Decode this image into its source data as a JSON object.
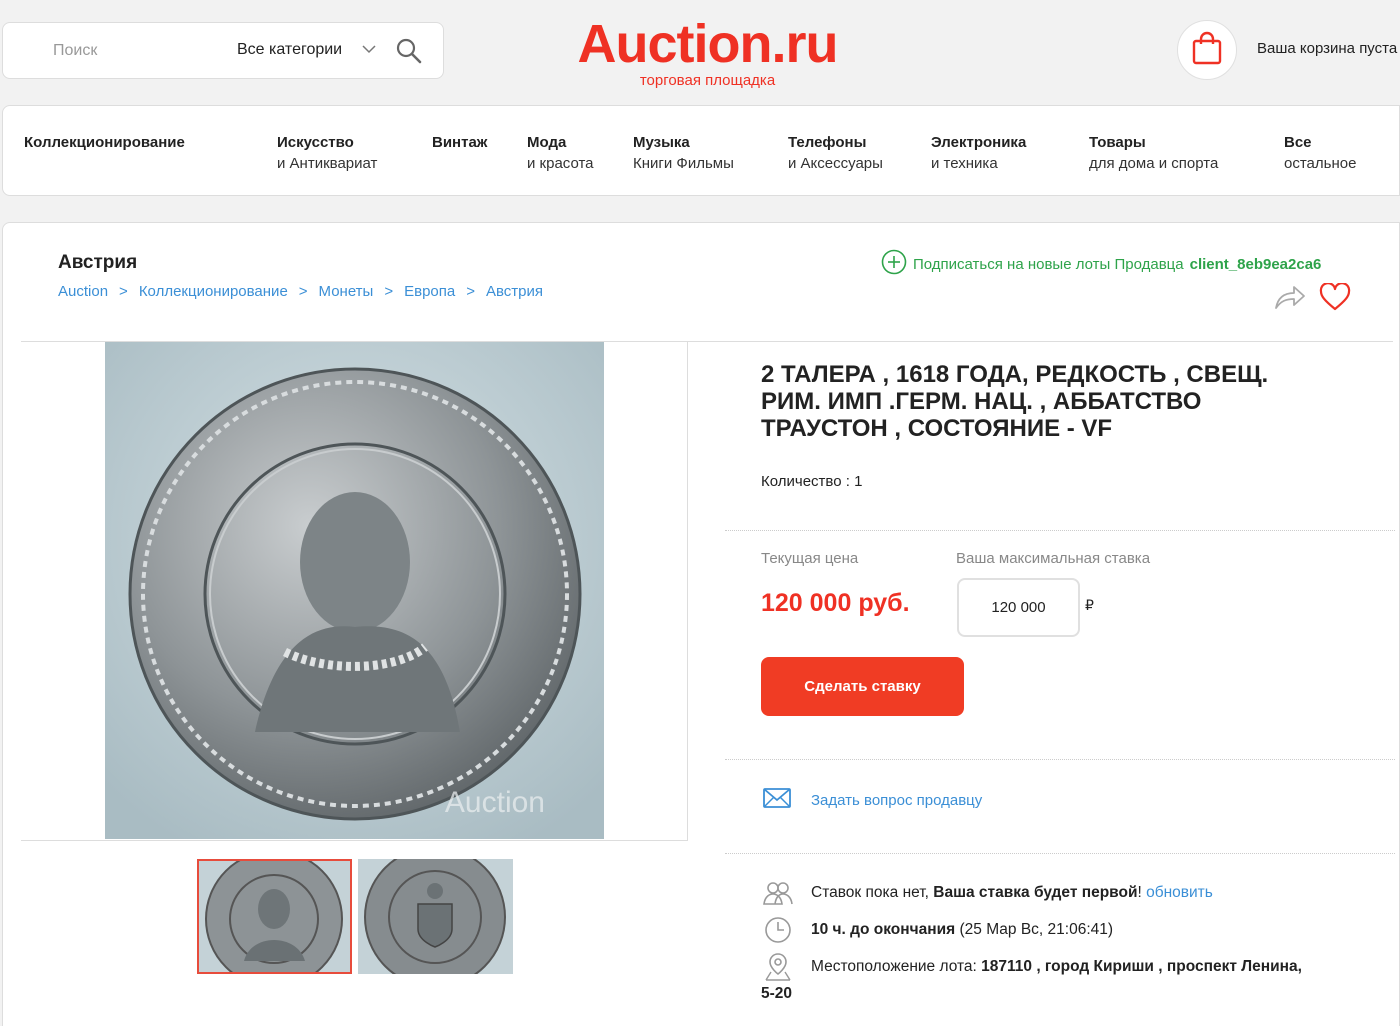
{
  "header": {
    "search_placeholder": "Поиск",
    "category_select": "Все категории",
    "logo_main": "Auction.ru",
    "logo_sub": "торговая площадка",
    "cart_text": "Ваша корзина пуста"
  },
  "nav": [
    {
      "line1": "Коллекционирование",
      "line2": ""
    },
    {
      "line1": "Искусство",
      "line2": "и Антиквариат"
    },
    {
      "line1": "Винтаж",
      "line2": ""
    },
    {
      "line1": "Мода",
      "line2": "и красота"
    },
    {
      "line1": "Музыка",
      "line2": "Книги Фильмы"
    },
    {
      "line1": "Телефоны",
      "line2": "и Аксессуары"
    },
    {
      "line1": "Электроника",
      "line2": "и техника"
    },
    {
      "line1": "Товары",
      "line2": "для дома и спорта"
    },
    {
      "line1": "Все",
      "line2": "остальное"
    }
  ],
  "page": {
    "title": "Австрия",
    "breadcrumb": [
      "Auction",
      "Коллекционирование",
      "Монеты",
      "Европа",
      "Австрия"
    ],
    "breadcrumb_separator": ">",
    "subscribe_text": "Подписаться на новые лоты Продавца",
    "seller_name": "client_8eb9ea2ca6"
  },
  "lot": {
    "title": "2 ТАЛЕРА , 1618 ГОДА, РЕДКОСТЬ , СВЕЩ. РИМ. ИМП .ГЕРМ. НАЦ. , АББАТСТВО ТРАУСТОН , СОСТОЯНИЕ - VF",
    "quantity_label": "Количество :",
    "quantity_value": "1",
    "current_price_label": "Текущая цена",
    "current_price": "120 000 руб.",
    "max_bid_label": "Ваша максимальная ставка",
    "max_bid_value": "120 000",
    "currency_symbol": "₽",
    "bid_button": "Сделать ставку",
    "ask_seller": "Задать вопрос продавцу",
    "no_bids_text": "Ставок пока нет,",
    "first_bid_text": "Ваша ставка будет первой",
    "exclamation": "!",
    "refresh_link": "обновить",
    "time_left": "10 ч. до окончания",
    "end_date": "(25 Мар Вс, 21:06:41)",
    "location_label": "Местоположение лота:",
    "location_value": "187110 , город Кириши , проспект Ленина,",
    "location_tail": "5-20",
    "watermark": "Auction"
  },
  "colors": {
    "brand_red": "#ef3124",
    "link_blue": "#3b8fd6",
    "subscribe_green": "#2ea34a"
  },
  "icons": [
    "search-icon",
    "chevron-down-icon",
    "shopping-bag-icon",
    "plus-circle-icon",
    "share-icon",
    "heart-icon",
    "envelope-icon",
    "users-icon",
    "clock-icon",
    "map-pin-icon"
  ]
}
